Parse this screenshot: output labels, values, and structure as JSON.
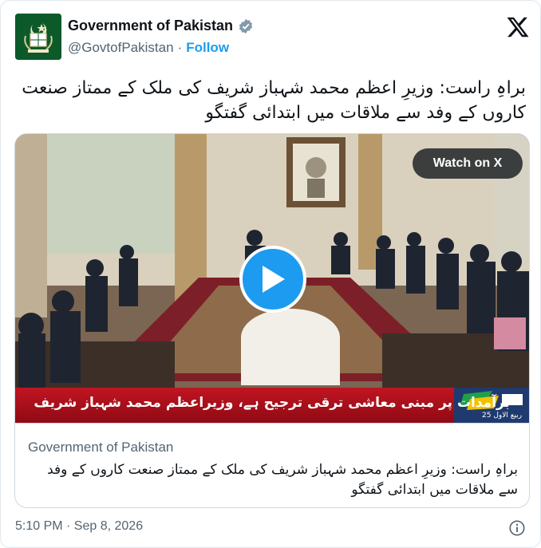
{
  "author": {
    "display_name": "Government of Pakistan",
    "handle": "@GovtofPakistan",
    "separator": "·",
    "follow_label": "Follow"
  },
  "tweet": {
    "text": "براہِ راست: وزیرِ اعظم محمد شہباز شریف کی ملک کے ممتاز صنعت کاروں کے وفد سے ملاقات میں ابتدائی گفتگو"
  },
  "video": {
    "watch_label": "Watch on X",
    "ticker_text": "برآمدات پر مبنی معاشی ترقی ترجیح ہے، وزیراعظم محمد شہباز شریف",
    "ticker_date": "25 ربیع الاول"
  },
  "link_preview": {
    "source": "Government of Pakistan",
    "title": "براہِ راست: وزیرِ اعظم محمد شہباز شریف کی ملک کے ممتاز صنعت کاروں کے وفد سے ملاقات میں ابتدائی گفتگو"
  },
  "footer": {
    "timestamp": "5:10 PM · Sep 8, 2026"
  },
  "colors": {
    "accent": "#1d9bf0",
    "verified": "#829aab",
    "ticker_red": "#c01522"
  },
  "icons": [
    "verified-badge-icon",
    "x-logo-icon",
    "play-icon",
    "info-icon",
    "emblem-icon"
  ]
}
